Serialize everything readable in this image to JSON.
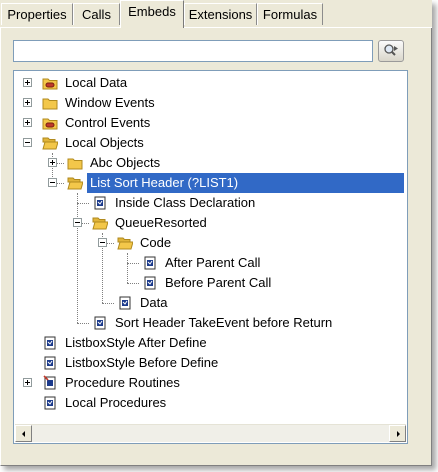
{
  "tabs": [
    {
      "label": "Properties",
      "active": false
    },
    {
      "label": "Calls",
      "active": false
    },
    {
      "label": "Embeds",
      "active": true
    },
    {
      "label": "Extensions",
      "active": false
    },
    {
      "label": "Formulas",
      "active": false
    }
  ],
  "search": {
    "value": "",
    "placeholder": "",
    "button_icon": "find-icon"
  },
  "tree": {
    "items": [
      {
        "label": "Local Data",
        "icon": "folder-filled-icon",
        "expander": "plus",
        "level": 0
      },
      {
        "label": "Window Events",
        "icon": "folder-icon",
        "expander": "plus",
        "level": 0
      },
      {
        "label": "Control Events",
        "icon": "folder-filled-icon",
        "expander": "plus",
        "level": 0
      },
      {
        "label": "Local Objects",
        "icon": "folder-open-icon",
        "expander": "minus",
        "level": 0
      },
      {
        "label": "Abc Objects",
        "icon": "folder-icon",
        "expander": "plus",
        "level": 1
      },
      {
        "label": "List Sort Header (?LIST1)",
        "icon": "folder-open-icon",
        "expander": "minus",
        "level": 1,
        "selected": true
      },
      {
        "label": "Inside Class Declaration",
        "icon": "embed-icon",
        "level": 2
      },
      {
        "label": "QueueResorted",
        "icon": "folder-open-icon",
        "expander": "minus",
        "level": 2
      },
      {
        "label": "Code",
        "icon": "folder-open-icon",
        "expander": "minus",
        "level": 3
      },
      {
        "label": "After Parent Call",
        "icon": "embed-icon",
        "level": 4
      },
      {
        "label": "Before Parent Call",
        "icon": "embed-icon",
        "level": 4
      },
      {
        "label": "Data",
        "icon": "embed-icon",
        "level": 3
      },
      {
        "label": "Sort Header TakeEvent before Return",
        "icon": "embed-icon",
        "level": 2
      },
      {
        "label": "ListboxStyle After Define",
        "icon": "embed-icon",
        "level": 0
      },
      {
        "label": "ListboxStyle Before Define",
        "icon": "embed-icon",
        "level": 0
      },
      {
        "label": "Procedure Routines",
        "icon": "embed-red-icon",
        "expander": "plus",
        "level": 0
      },
      {
        "label": "Local Procedures",
        "icon": "embed-icon",
        "level": 0
      }
    ]
  },
  "colors": {
    "selection": "#3169c6",
    "panel": "#ece9d8",
    "folder": "#f3c74a"
  }
}
